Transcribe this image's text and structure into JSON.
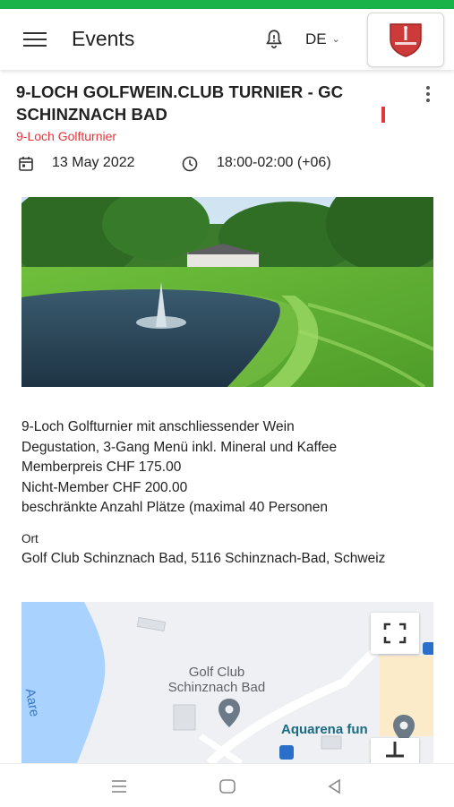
{
  "header": {
    "title": "Events",
    "language": "DE",
    "icons": [
      "menu-icon",
      "bell-icon",
      "chevron-down-icon"
    ]
  },
  "event": {
    "title": "9-LOCH GOLFWEIN.CLUB TURNIER - GC SCHINZNACH BAD",
    "subtitle": "9-Loch Golfturnier",
    "date": "13 May 2022",
    "time": "18:00-02:00 (+06)",
    "description_lines": [
      "9-Loch Golfturnier mit anschliessender Wein",
      "Degustation, 3-Gang Menü inkl. Mineral und Kaffee",
      "Memberpreis CHF 175.00",
      "Nicht-Member CHF 200.00",
      "beschränkte Anzahl Plätze (maximal 40 Personen"
    ],
    "location_label": "Ort",
    "address": "Golf Club Schinznach Bad, 5116 Schinznach-Bad, Schweiz"
  },
  "map": {
    "place_label": "Golf Club\nSchinznach Bad",
    "poi_label": "Aquarena fun",
    "river_label": "Aare"
  },
  "colors": {
    "status_bar": "#19b34a",
    "accent_red": "#e0373b",
    "river": "#a9d2ff",
    "marker": "#6b7a86"
  }
}
